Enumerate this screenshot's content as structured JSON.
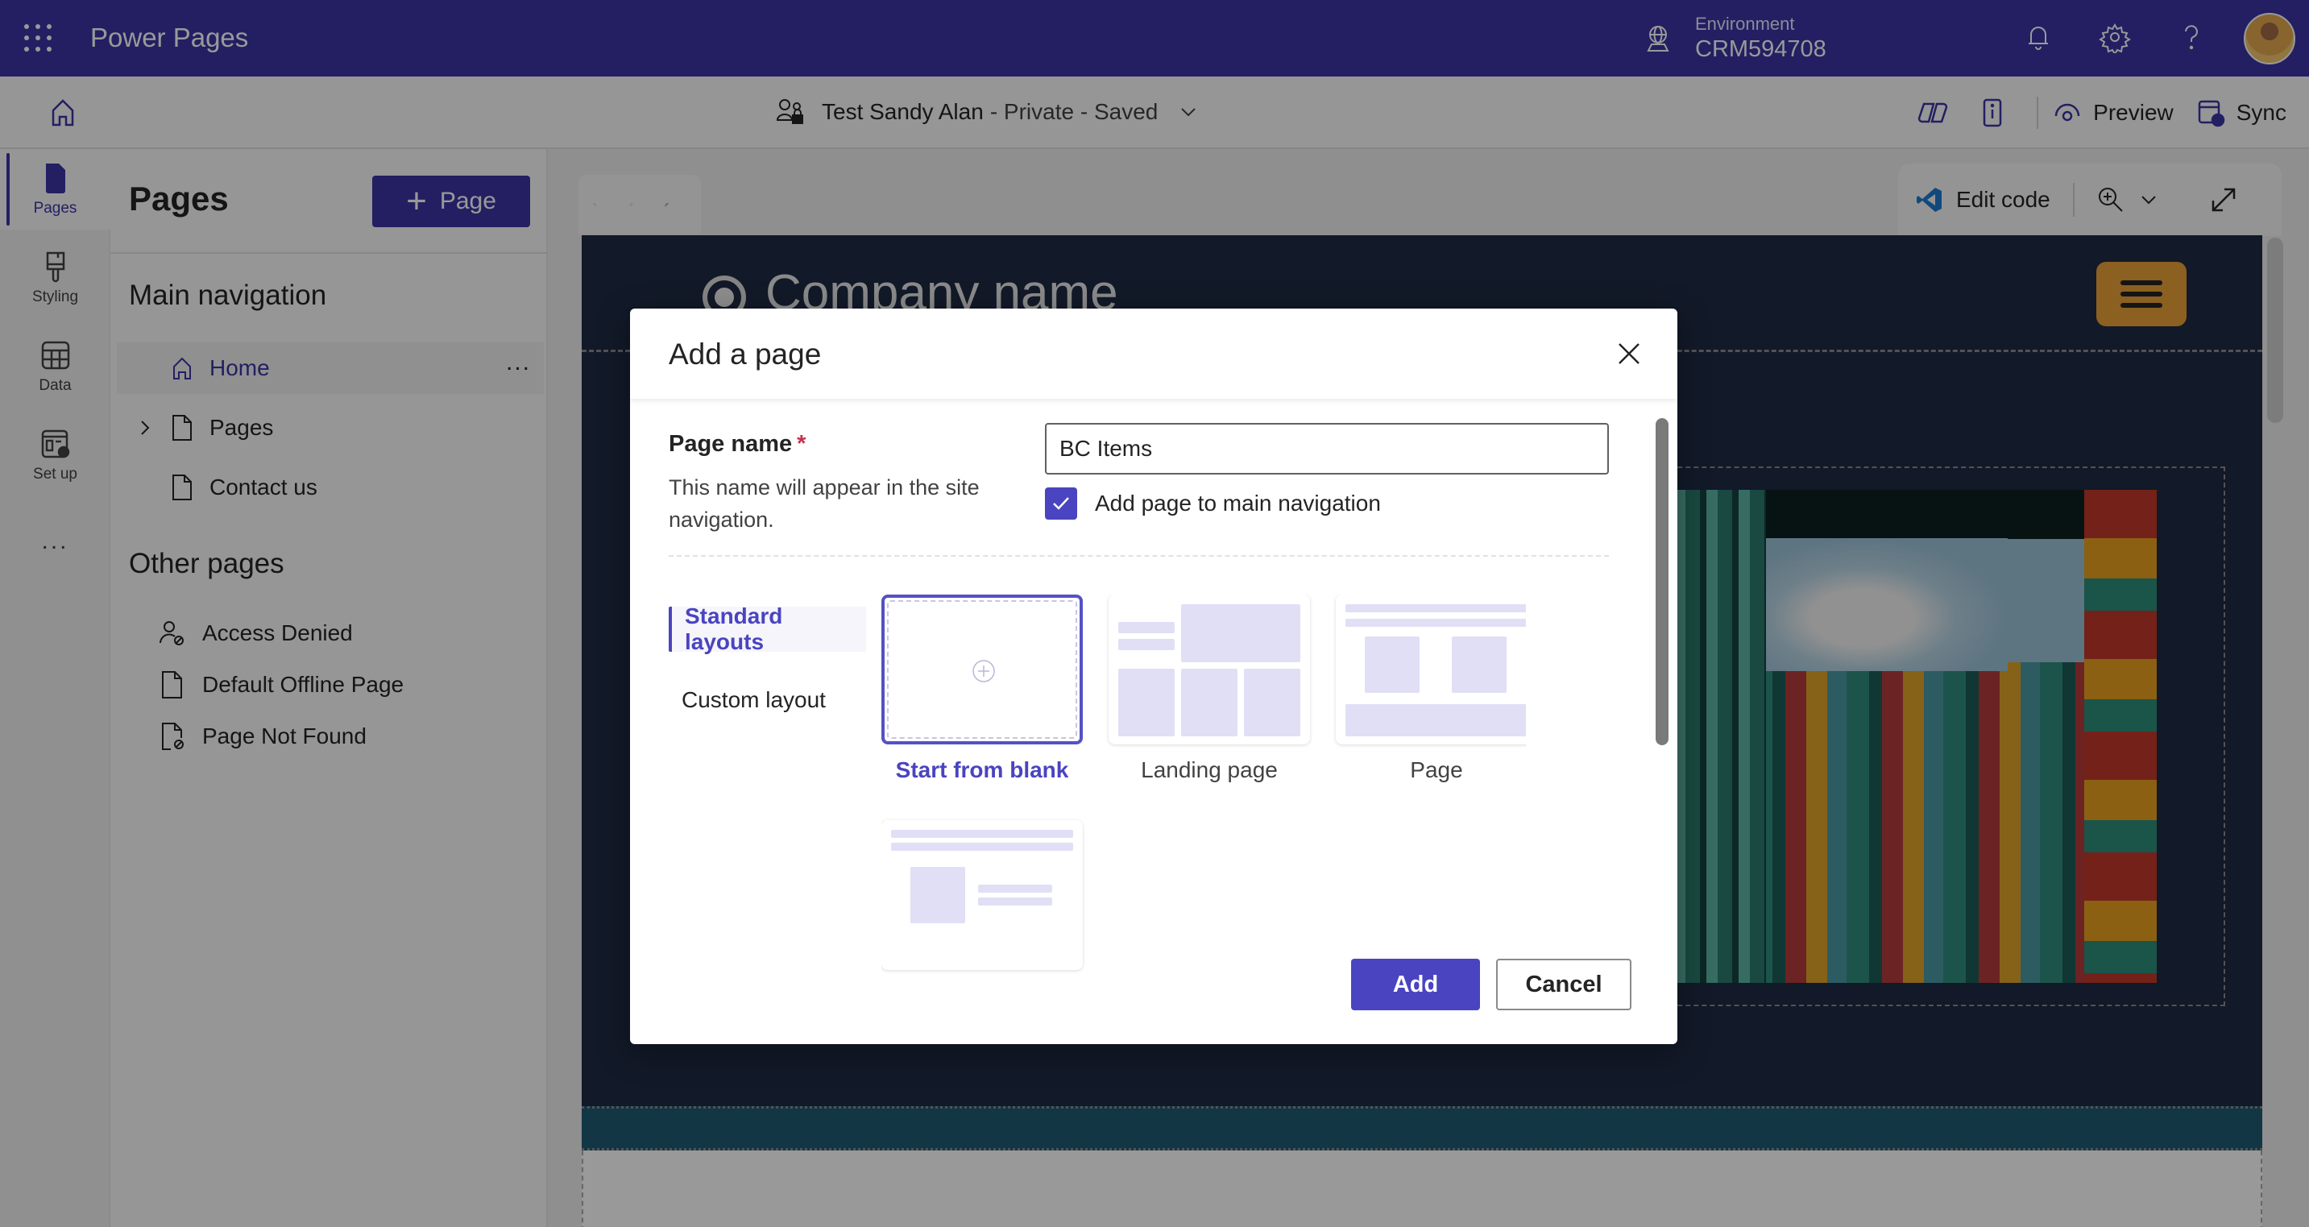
{
  "app": {
    "title": "Power Pages",
    "environment_label": "Environment",
    "environment_value": "CRM594708"
  },
  "commandbar": {
    "site_name": "Test Sandy Alan",
    "site_status": "- Private - Saved",
    "preview_label": "Preview",
    "sync_label": "Sync"
  },
  "rail": {
    "items": [
      {
        "label": "Pages",
        "icon": "page-icon",
        "active": true
      },
      {
        "label": "Styling",
        "icon": "paintbrush-icon",
        "active": false
      },
      {
        "label": "Data",
        "icon": "table-icon",
        "active": false
      },
      {
        "label": "Set up",
        "icon": "setup-gear-icon",
        "active": false
      }
    ],
    "more": "..."
  },
  "panel": {
    "title": "Pages",
    "add_button_label": "Page",
    "main_navigation_title": "Main navigation",
    "main_navigation": [
      {
        "label": "Home",
        "icon": "home-icon",
        "selected": true,
        "expandable": false
      },
      {
        "label": "Pages",
        "icon": "page-icon",
        "selected": false,
        "expandable": true
      },
      {
        "label": "Contact us",
        "icon": "page-icon",
        "selected": false,
        "expandable": false
      }
    ],
    "other_pages_title": "Other pages",
    "other_pages": [
      {
        "label": "Access Denied",
        "icon": "person-blocked-icon"
      },
      {
        "label": "Default Offline Page",
        "icon": "page-icon"
      },
      {
        "label": "Page Not Found",
        "icon": "page-blocked-icon"
      }
    ],
    "more_label": "..."
  },
  "canvas": {
    "edit_code_label": "Edit code",
    "company_name": "Company name"
  },
  "dialog": {
    "title": "Add a page",
    "field_label": "Page name",
    "required_marker": "*",
    "field_help": "This name will appear in the site navigation.",
    "field_value": "BC Items",
    "checkbox_label": "Add page to main navigation",
    "checkbox_checked": true,
    "layout_tabs": [
      {
        "label": "Standard layouts",
        "active": true
      },
      {
        "label": "Custom layout",
        "active": false
      }
    ],
    "layouts": [
      {
        "label": "Start from blank",
        "selected": true
      },
      {
        "label": "Landing page",
        "selected": false
      },
      {
        "label": "Page",
        "selected": false
      },
      {
        "label": "",
        "selected": false
      }
    ],
    "add_label": "Add",
    "cancel_label": "Cancel"
  },
  "colors": {
    "brand": "#3b35a3",
    "accent": "#4a44c0",
    "canvas_bg": "#1f2a44",
    "menu_button": "#e8a036"
  }
}
